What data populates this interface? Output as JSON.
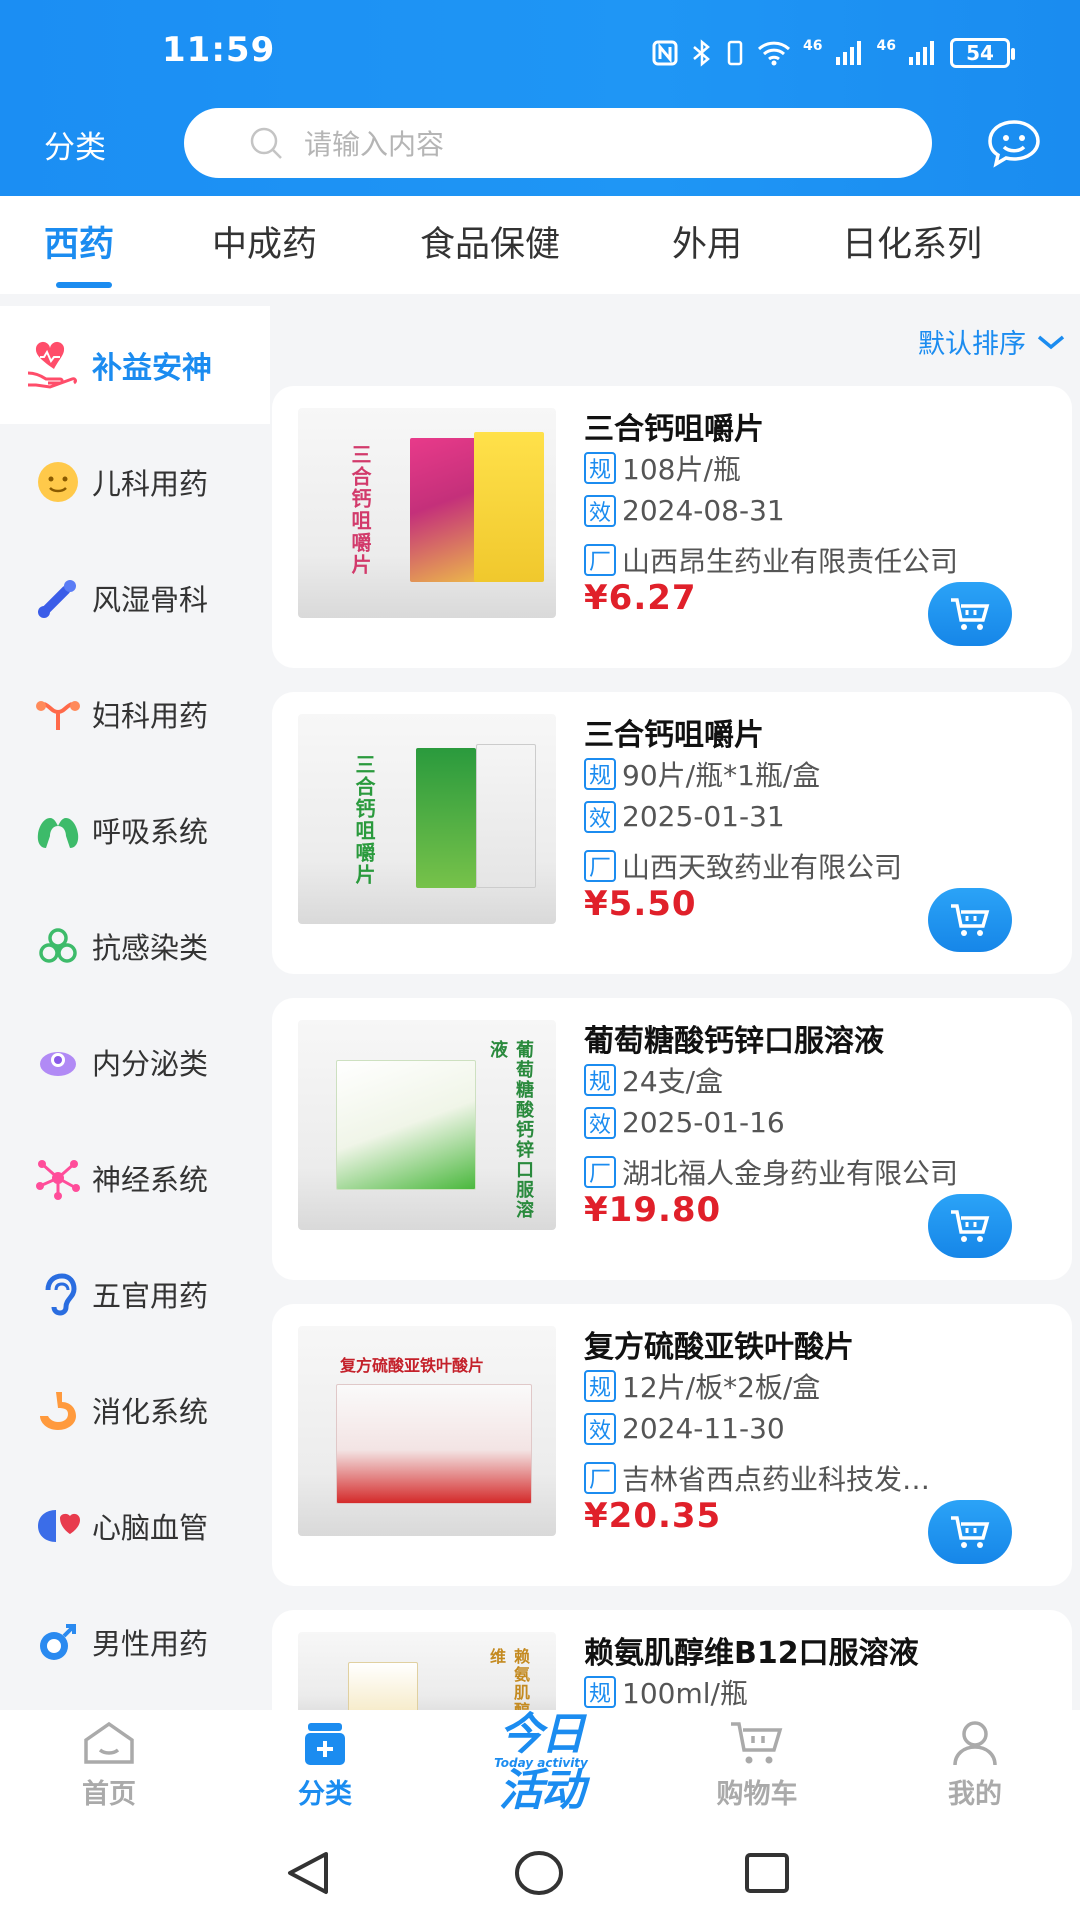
{
  "status_bar": {
    "time": "11:59",
    "network_1": "46",
    "network_2": "46",
    "battery": "54"
  },
  "header": {
    "category_label": "分类",
    "search_placeholder": "请输入内容"
  },
  "tabs": [
    {
      "label": "西药",
      "active": true
    },
    {
      "label": "中成药",
      "active": false
    },
    {
      "label": "食品保健",
      "active": false
    },
    {
      "label": "外用",
      "active": false
    },
    {
      "label": "日化系列",
      "active": false
    }
  ],
  "sidebar": {
    "items": [
      {
        "label": "补益安神",
        "icon": "heart-hand-icon",
        "active": true
      },
      {
        "label": "儿科用药",
        "icon": "child-face-icon",
        "active": false
      },
      {
        "label": "风湿骨科",
        "icon": "bone-icon",
        "active": false
      },
      {
        "label": "妇科用药",
        "icon": "uterus-icon",
        "active": false
      },
      {
        "label": "呼吸系统",
        "icon": "lungs-icon",
        "active": false
      },
      {
        "label": "抗感染类",
        "icon": "biohazard-icon",
        "active": false
      },
      {
        "label": "内分泌类",
        "icon": "gland-icon",
        "active": false
      },
      {
        "label": "神经系统",
        "icon": "neuron-icon",
        "active": false
      },
      {
        "label": "五官用药",
        "icon": "ear-icon",
        "active": false
      },
      {
        "label": "消化系统",
        "icon": "stomach-icon",
        "active": false
      },
      {
        "label": "心脑血管",
        "icon": "brain-heart-icon",
        "active": false
      },
      {
        "label": "男性用药",
        "icon": "male-symbol-icon",
        "active": false
      }
    ]
  },
  "sort": {
    "label": "默认排序"
  },
  "tag_labels": {
    "spec": "规",
    "expiry": "效",
    "maker": "厂"
  },
  "products": [
    {
      "name": "三合钙咀嚼片",
      "spec": "108片/瓶",
      "expiry": "2024-08-31",
      "maker": "山西昂生药业有限责任公司",
      "price": "¥6.27",
      "thumb_text": "三合钙咀嚼片"
    },
    {
      "name": "三合钙咀嚼片",
      "spec": "90片/瓶*1瓶/盒",
      "expiry": "2025-01-31",
      "maker": "山西天致药业有限公司",
      "price": "¥5.50",
      "thumb_text": "三合钙咀嚼片"
    },
    {
      "name": "葡萄糖酸钙锌口服溶液",
      "spec": "24支/盒",
      "expiry": "2025-01-16",
      "maker": "湖北福人金身药业有限公司",
      "price": "¥19.80",
      "thumb_text": "葡萄糖酸钙锌口服溶液"
    },
    {
      "name": "复方硫酸亚铁叶酸片",
      "spec": "12片/板*2板/盒",
      "expiry": "2024-11-30",
      "maker": "吉林省西点药业科技发…",
      "price": "¥20.35",
      "thumb_text": "复方硫酸亚铁叶酸片"
    },
    {
      "name": "赖氨肌醇维B12口服溶液",
      "spec": "100ml/瓶",
      "thumb_text": "赖氨肌醇维"
    }
  ],
  "bottom_nav": {
    "home": "首页",
    "category": "分类",
    "promo_line1": "今日",
    "promo_en": "Today activity",
    "promo_line2": "活动",
    "cart": "购物车",
    "mine": "我的"
  },
  "colors": {
    "accent": "#1b8cf0",
    "price": "#e0202a",
    "header_bg": "#1b8ef3"
  }
}
